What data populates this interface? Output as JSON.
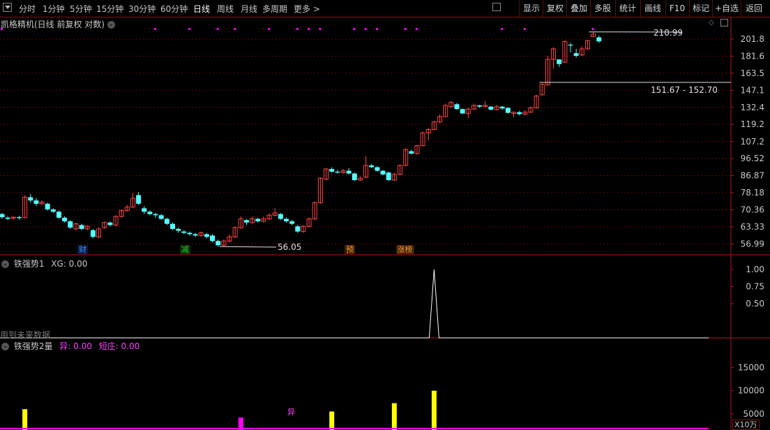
{
  "toolbar": {
    "timeframes": [
      "分时",
      "1分钟",
      "5分钟",
      "15分钟",
      "30分钟",
      "60分钟",
      "日线",
      "周线",
      "月线",
      "多周期",
      "更多 >"
    ],
    "active_timeframe": "日线",
    "buttons": [
      "显示",
      "复权",
      "叠加",
      "多股",
      "统计",
      "画线",
      "F10",
      "标记",
      "+自选",
      "返回"
    ]
  },
  "main_panel": {
    "title": "凯格精机(日线 前复权 对数)",
    "high_label": "210.99",
    "low_label": "56.05",
    "range_label": "151.67 - 152.70",
    "events": [
      {
        "text": "财",
        "color": "#3c8cff",
        "bg": "#0a1a40",
        "i": 14
      },
      {
        "text": "减",
        "color": "#30c030",
        "bg": "#0a300a",
        "i": 32
      },
      {
        "text": "预",
        "color": "#ff9030",
        "bg": "#402008",
        "i": 61
      },
      {
        "text": "涨榜",
        "color": "#ff9030",
        "bg": "#402008",
        "i": 70
      }
    ],
    "colors": {
      "up": "#ff4444",
      "down": "#54ffff",
      "grid": "#5a0a0a",
      "axis_text": "#c8c8c8",
      "marker": "#ff00ff"
    }
  },
  "indicator1": {
    "title": "铁强势1",
    "xg_label": "XG: 0.00",
    "note": "用到未来数据",
    "y_ticks": [
      "1.00",
      "0.75",
      "0.50"
    ]
  },
  "indicator2": {
    "title": "铁强势2量",
    "yi_label": "异: 0.00",
    "duanzhuang_label": "短庄: 0.00",
    "y_ticks": [
      "15000",
      "10000",
      "5000"
    ],
    "unit_label": "X10万",
    "bar_marker_text": "异"
  },
  "chart_data": [
    {
      "type": "candlestick",
      "title": "凯格精机(日线 前复权 对数)",
      "scale": "log",
      "y_ticks": [
        201.8,
        181.6,
        163.5,
        147.1,
        132.4,
        119.2,
        107.2,
        96.52,
        86.87,
        78.18,
        70.36,
        63.33,
        56.99
      ],
      "ylim": [
        53.5,
        220
      ],
      "candles": [
        [
          68.5,
          67.2,
          69.0,
          66.5
        ],
        [
          67.0,
          66.5,
          67.5,
          66.0
        ],
        [
          66.8,
          67.2,
          67.5,
          66.0
        ],
        [
          67.2,
          66.8,
          67.8,
          66.2
        ],
        [
          67.0,
          76.0,
          77.0,
          66.8
        ],
        [
          76.0,
          74.5,
          77.5,
          73.5
        ],
        [
          74.5,
          73.0,
          75.5,
          72.0
        ],
        [
          73.0,
          73.8,
          74.5,
          72.5
        ],
        [
          73.0,
          70.5,
          73.5,
          70.0
        ],
        [
          70.5,
          69.5,
          71.0,
          69.0
        ],
        [
          69.5,
          67.0,
          70.0,
          66.5
        ],
        [
          67.0,
          65.5,
          67.5,
          65.0
        ],
        [
          65.5,
          63.0,
          66.0,
          62.5
        ],
        [
          62.5,
          64.5,
          65.0,
          62.0
        ],
        [
          64.0,
          62.5,
          64.5,
          62.0
        ],
        [
          62.5,
          63.5,
          64.0,
          62.0
        ],
        [
          62.0,
          59.5,
          62.5,
          59.0
        ],
        [
          59.5,
          62.5,
          63.0,
          59.0
        ],
        [
          63.0,
          65.0,
          65.5,
          62.5
        ],
        [
          65.0,
          64.0,
          65.5,
          63.5
        ],
        [
          64.0,
          67.5,
          68.0,
          63.5
        ],
        [
          67.5,
          70.0,
          70.5,
          67.0
        ],
        [
          70.0,
          71.5,
          72.5,
          69.5
        ],
        [
          71.5,
          75.5,
          78.0,
          71.0
        ],
        [
          77.0,
          73.0,
          78.5,
          72.5
        ],
        [
          71.0,
          69.5,
          72.0,
          68.5
        ],
        [
          69.5,
          68.5,
          70.0,
          68.0
        ],
        [
          68.5,
          68.0,
          69.0,
          67.0
        ],
        [
          68.0,
          66.5,
          68.5,
          66.0
        ],
        [
          66.5,
          64.5,
          67.0,
          64.0
        ],
        [
          64.5,
          62.5,
          65.0,
          62.0
        ],
        [
          62.5,
          61.8,
          63.0,
          61.0
        ],
        [
          61.5,
          61.0,
          62.0,
          60.5
        ],
        [
          61.0,
          60.5,
          61.5,
          60.0
        ],
        [
          60.5,
          60.0,
          61.0,
          59.5
        ],
        [
          60.0,
          61.0,
          61.5,
          59.5
        ],
        [
          60.5,
          59.5,
          61.0,
          59.0
        ],
        [
          60.0,
          58.0,
          60.5,
          57.5
        ],
        [
          58.0,
          56.5,
          58.5,
          56.05
        ],
        [
          56.5,
          58.0,
          58.5,
          56.2
        ],
        [
          58.0,
          59.5,
          60.5,
          57.5
        ],
        [
          59.5,
          63.0,
          63.5,
          59.0
        ],
        [
          63.0,
          66.5,
          67.5,
          62.5
        ],
        [
          66.0,
          65.0,
          66.5,
          64.0
        ],
        [
          65.0,
          66.5,
          67.5,
          64.5
        ],
        [
          66.5,
          65.5,
          67.0,
          65.0
        ],
        [
          65.5,
          66.5,
          67.5,
          65.0
        ],
        [
          66.5,
          68.0,
          69.0,
          66.0
        ],
        [
          68.0,
          69.0,
          71.0,
          67.5
        ],
        [
          68.5,
          66.5,
          69.0,
          66.0
        ],
        [
          66.5,
          65.5,
          67.0,
          65.0
        ],
        [
          65.5,
          64.5,
          66.0,
          64.0
        ],
        [
          63.5,
          61.5,
          64.0,
          61.0
        ],
        [
          61.5,
          63.5,
          64.0,
          61.0
        ],
        [
          63.5,
          66.5,
          67.0,
          63.0
        ],
        [
          66.5,
          73.5,
          74.0,
          66.0
        ],
        [
          73.5,
          85.5,
          86.0,
          73.0
        ],
        [
          85.0,
          90.5,
          91.0,
          84.5
        ],
        [
          90.5,
          89.0,
          91.5,
          88.5
        ],
        [
          89.0,
          88.5,
          90.0,
          88.0
        ],
        [
          88.5,
          89.5,
          90.5,
          88.0
        ],
        [
          89.5,
          88.0,
          91.0,
          87.5
        ],
        [
          88.0,
          84.5,
          88.5,
          84.0
        ],
        [
          84.5,
          85.5,
          86.5,
          84.0
        ],
        [
          86.0,
          92.5,
          98.0,
          85.5
        ],
        [
          92.5,
          91.5,
          93.5,
          91.0
        ],
        [
          91.5,
          89.5,
          92.0,
          89.0
        ],
        [
          89.5,
          87.5,
          90.0,
          87.0
        ],
        [
          88.5,
          84.5,
          89.0,
          84.0
        ],
        [
          84.5,
          87.5,
          88.5,
          84.0
        ],
        [
          87.5,
          92.5,
          93.0,
          87.0
        ],
        [
          92.5,
          102.0,
          103.0,
          92.0
        ],
        [
          101.0,
          99.5,
          102.0,
          99.0
        ],
        [
          99.5,
          104.5,
          105.0,
          99.0
        ],
        [
          104.5,
          113.0,
          114.0,
          104.0
        ],
        [
          113.0,
          115.5,
          116.5,
          108.0
        ],
        [
          115.5,
          121.0,
          122.0,
          115.0
        ],
        [
          121.0,
          125.0,
          127.0,
          120.0
        ],
        [
          125.0,
          134.0,
          135.5,
          124.5
        ],
        [
          133.0,
          136.5,
          138.0,
          132.0
        ],
        [
          135.0,
          131.0,
          136.0,
          130.5
        ],
        [
          131.0,
          127.5,
          131.5,
          127.0
        ],
        [
          127.5,
          131.0,
          132.0,
          124.0
        ],
        [
          131.0,
          134.0,
          135.5,
          130.5
        ],
        [
          134.0,
          133.0,
          134.5,
          132.0
        ],
        [
          133.0,
          134.0,
          137.5,
          132.5
        ],
        [
          133.0,
          130.5,
          133.5,
          130.0
        ],
        [
          130.5,
          133.0,
          134.5,
          130.0
        ],
        [
          133.0,
          131.5,
          133.5,
          130.5
        ],
        [
          132.0,
          128.0,
          132.5,
          127.5
        ],
        [
          127.5,
          128.5,
          129.0,
          124.5
        ],
        [
          128.5,
          127.0,
          129.5,
          126.0
        ],
        [
          127.0,
          128.5,
          130.0,
          126.0
        ],
        [
          128.5,
          132.0,
          133.0,
          128.0
        ],
        [
          132.0,
          142.0,
          143.0,
          131.5
        ],
        [
          143.0,
          152.7,
          153.5,
          142.5
        ],
        [
          152.0,
          178.0,
          182.0,
          151.67
        ],
        [
          178.0,
          190.0,
          192.0,
          168.0
        ],
        [
          178.0,
          173.0,
          178.0,
          170.0
        ],
        [
          175.0,
          199.0,
          200.0,
          174.0
        ],
        [
          195.0,
          194.0,
          197.0,
          186.0
        ],
        [
          185.0,
          182.0,
          190.0,
          180.0
        ],
        [
          183.0,
          190.0,
          193.0,
          182.0
        ],
        [
          190.0,
          200.0,
          201.0,
          189.0
        ],
        [
          205.0,
          208.0,
          210.99,
          205.0
        ],
        [
          204.0,
          199.0,
          206.0,
          197.0
        ]
      ],
      "markers_top_indices": [
        0,
        27,
        33,
        38,
        41,
        47,
        52,
        54,
        56,
        62,
        64,
        66,
        71,
        73,
        88,
        92,
        104
      ],
      "annotations": [
        "210.99",
        "56.05",
        "151.67 - 152.70"
      ]
    },
    {
      "type": "line",
      "title": "铁强势1",
      "y_ticks": [
        1.0,
        0.75,
        0.5
      ],
      "ylim": [
        0,
        1
      ],
      "spike_index": 76,
      "values_note": "all 0 except 1.00 at spike_index"
    },
    {
      "type": "bar",
      "title": "铁强势2量",
      "y_ticks": [
        15000,
        10000,
        5000
      ],
      "ylim": [
        1500,
        19000
      ],
      "bars": [
        {
          "i": 4,
          "value": 6000,
          "color": "#ffff00"
        },
        {
          "i": 42,
          "value": 4200,
          "color": "#ff00ff"
        },
        {
          "i": 58,
          "value": 5500,
          "color": "#ffff00"
        },
        {
          "i": 69,
          "value": 7300,
          "color": "#ffff00"
        },
        {
          "i": 76,
          "value": 10000,
          "color": "#ffff00"
        }
      ]
    }
  ]
}
